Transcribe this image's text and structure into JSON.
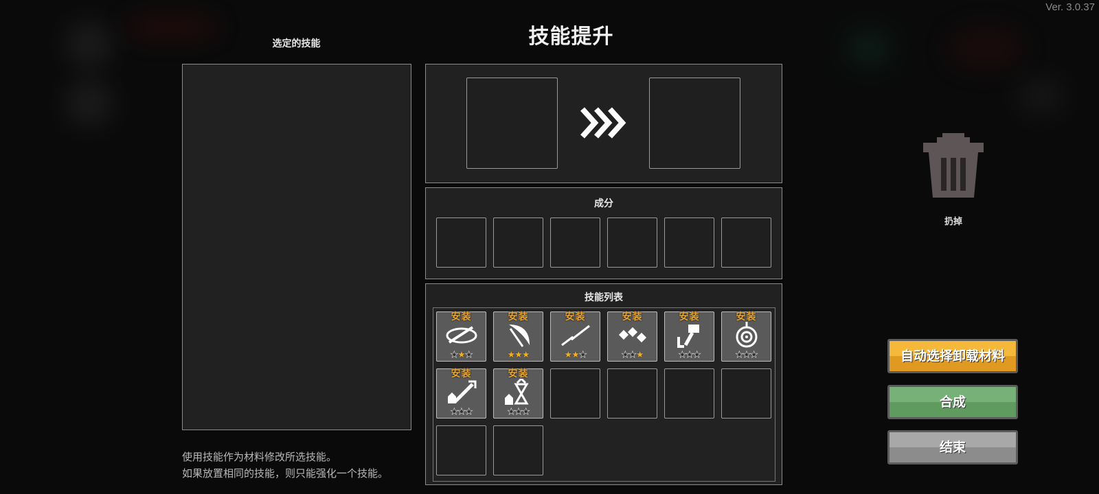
{
  "version": "Ver. 3.0.37",
  "title": "技能提升",
  "selected_skill": {
    "heading": "选定的技能"
  },
  "ingredients": {
    "heading": "成分"
  },
  "skill_list": {
    "heading": "技能列表",
    "equip_label": "安装",
    "items": [
      {
        "icon": "slash-arc-icon",
        "stars": 1
      },
      {
        "icon": "crescent-blade-icon",
        "stars": 3
      },
      {
        "icon": "lightning-spear-icon",
        "stars": 2
      },
      {
        "icon": "shuriken-chain-icon",
        "stars": 1
      },
      {
        "icon": "hammer-down-icon",
        "stars": 0
      },
      {
        "icon": "target-orb-icon",
        "stars": 0
      },
      {
        "icon": "sword-up-icon",
        "stars": 0
      },
      {
        "icon": "hourglass-up-icon",
        "stars": 0
      }
    ]
  },
  "trash": {
    "label": "扔掉"
  },
  "buttons": {
    "auto_select": "自动选择卸载材料",
    "combine": "合成",
    "end": "结束"
  },
  "description": {
    "line1": "使用技能作为材料修改所选技能。",
    "line2": "如果放置相同的技能，则只能强化一个技能。"
  },
  "colors": {
    "equip": "#e8a531",
    "auto_button": "#f5b83a",
    "combine_button": "#78b178",
    "end_button": "#a8a8a8"
  }
}
